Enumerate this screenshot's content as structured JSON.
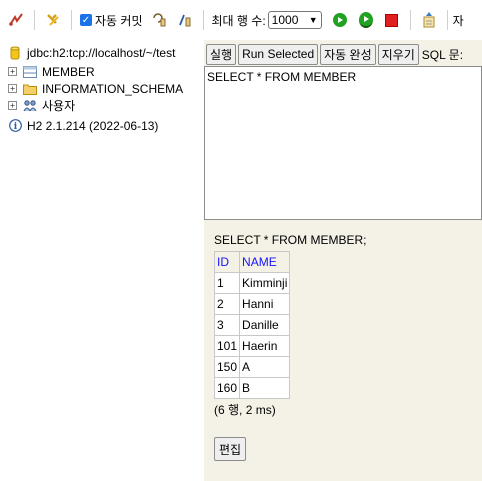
{
  "toolbar": {
    "autocommit_label": "자동 커밋",
    "autocommit_checked": true,
    "max_rows_label": "최대 행 수:",
    "max_rows_value": "1000",
    "overflow_label": "자"
  },
  "tree": {
    "connection": "jdbc:h2:tcp://localhost/~/test",
    "items": [
      {
        "label": "MEMBER",
        "expander": "+",
        "icon": "table-icon"
      },
      {
        "label": "INFORMATION_SCHEMA",
        "expander": "+",
        "icon": "folder-icon"
      },
      {
        "label": "사용자",
        "expander": "+",
        "icon": "users-icon"
      }
    ],
    "version": "H2 2.1.214 (2022-06-13)"
  },
  "commands": {
    "run": "실행",
    "run_selected": "Run Selected",
    "auto_complete": "자동 완성",
    "clear": "지우기",
    "sql_label": "SQL 문:"
  },
  "editor": {
    "sql": "SELECT * FROM MEMBER"
  },
  "result": {
    "query": "SELECT * FROM MEMBER;",
    "columns": [
      "ID",
      "NAME"
    ],
    "rows": [
      [
        "1",
        "Kimminji"
      ],
      [
        "2",
        "Hanni"
      ],
      [
        "3",
        "Danille"
      ],
      [
        "101",
        "Haerin"
      ],
      [
        "150",
        "A"
      ],
      [
        "160",
        "B"
      ]
    ],
    "summary": "(6 행, 2 ms)",
    "edit_label": "편집"
  },
  "colors": {
    "panel_bg": "#f4f1e7",
    "header_link": "#1414ff",
    "run_green": "#21a321",
    "stop_red": "#e02020"
  }
}
